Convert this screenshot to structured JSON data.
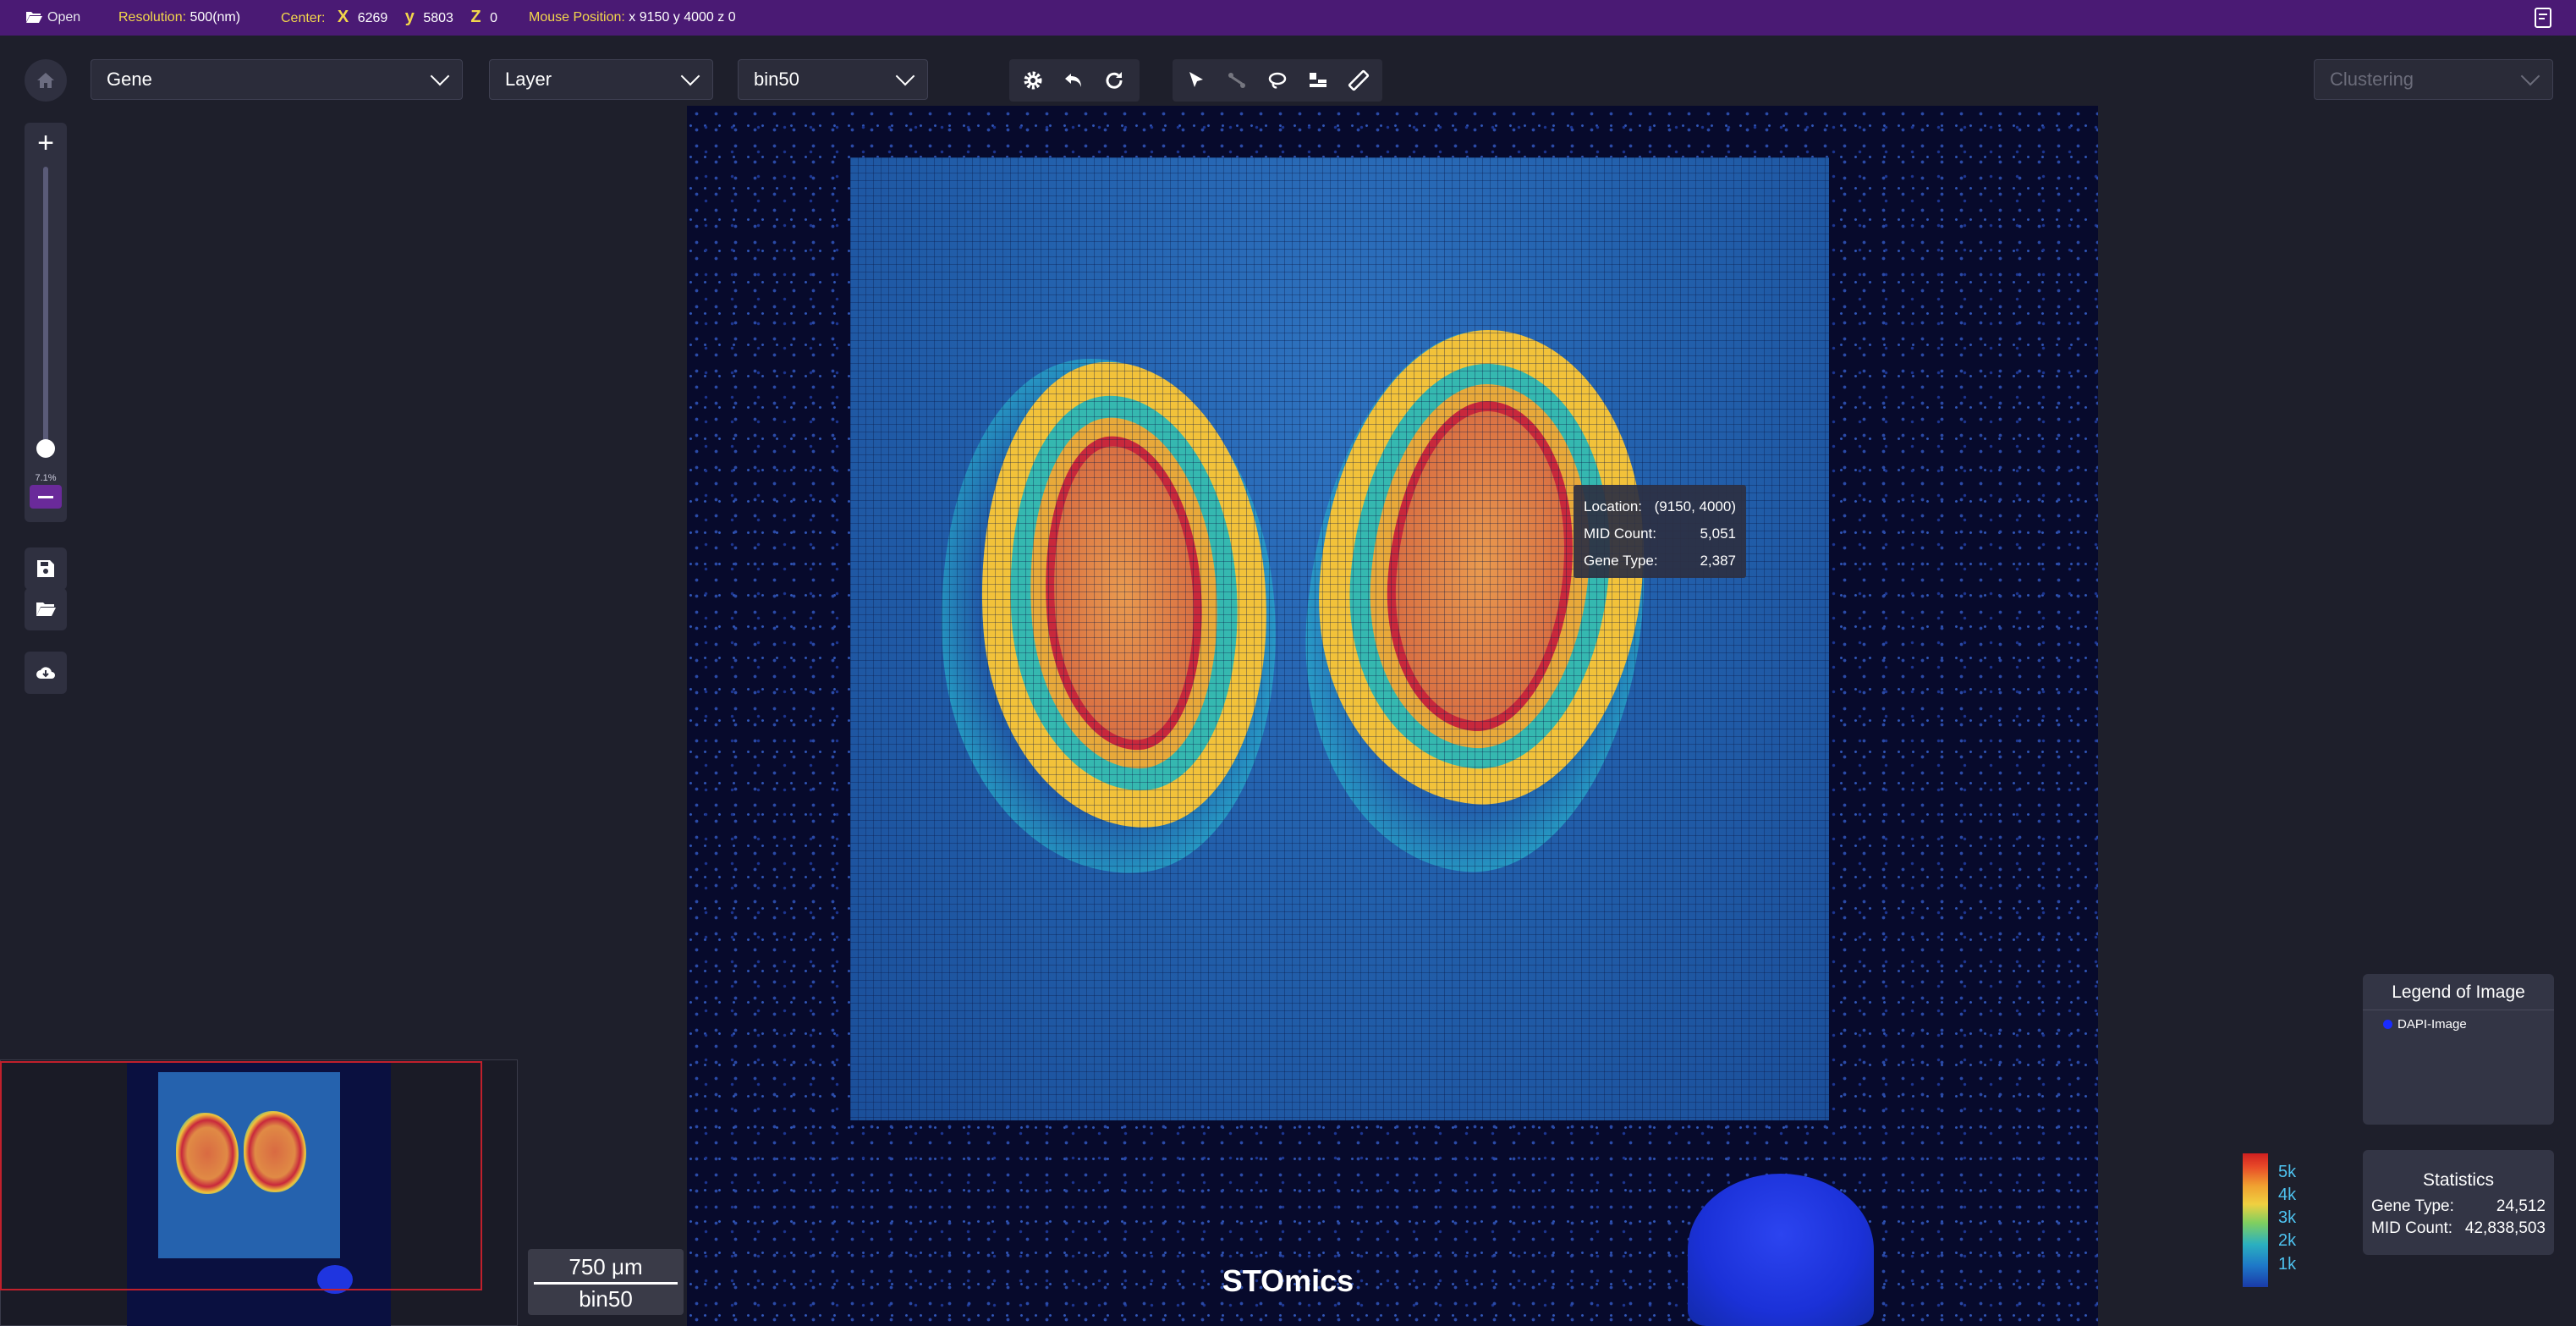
{
  "topbar": {
    "open_label": "Open",
    "resolution_label": "Resolution:",
    "resolution_value": "500(nm)",
    "center_label": "Center:",
    "center_x_label": "X",
    "center_x": "6269",
    "center_y_label": "y",
    "center_y": "5803",
    "center_z_label": "Z",
    "center_z": "0",
    "mouse_label": "Mouse Position:",
    "mouse_value": "x 9150  y 4000  z 0"
  },
  "selectors": {
    "gene": "Gene",
    "layer": "Layer",
    "bin": "bin50",
    "clustering": "Clustering"
  },
  "toolbar_icons": [
    "gear-icon",
    "undo-icon",
    "redo-icon",
    "pointer-icon",
    "connect-icon",
    "lasso-icon",
    "layers-icon",
    "ruler-icon"
  ],
  "zoom": {
    "percent_label": "7.1%",
    "level": 0.071
  },
  "tooltip": {
    "location_label": "Location:",
    "location_value": "(9150, 4000)",
    "mid_label": "MID Count:",
    "mid_value": "5,051",
    "gene_label": "Gene Type:",
    "gene_value": "2,387"
  },
  "scale": {
    "length": "750 μm",
    "bin": "bin50"
  },
  "watermark": "STOmics",
  "legend": {
    "title": "Legend of Image",
    "items": [
      {
        "label": "DAPI-Image",
        "color": "#1a2cff"
      }
    ]
  },
  "statistics": {
    "title": "Statistics",
    "gene_type_label": "Gene Type:",
    "gene_type_value": "24,512",
    "mid_count_label": "MID Count:",
    "mid_count_value": "42,838,503"
  },
  "colorbar": {
    "ticks": [
      "5k",
      "4k",
      "3k",
      "2k",
      "1k"
    ]
  },
  "colors": {
    "topbar": "#4a1a74",
    "accent_yellow": "#f2d64b",
    "tick_blue": "#4ec3f0"
  }
}
